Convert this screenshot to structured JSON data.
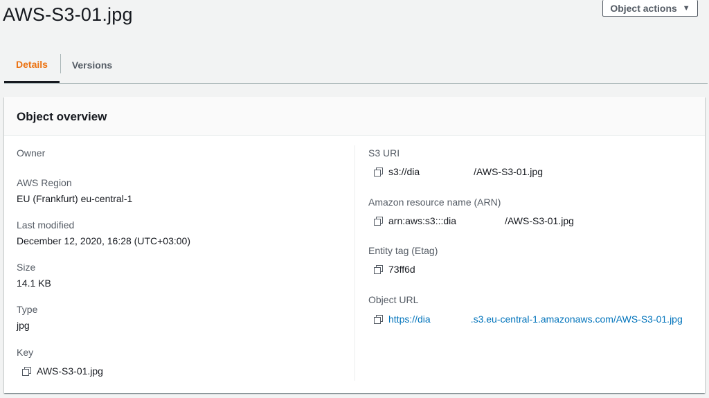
{
  "page": {
    "title": "AWS-S3-01.jpg",
    "actions_label": "Object actions",
    "actions_caret": "▼"
  },
  "tabs": [
    {
      "label": "Details",
      "active": true
    },
    {
      "label": "Versions",
      "active": false
    }
  ],
  "overview": {
    "title": "Object overview",
    "left": {
      "owner_label": "Owner",
      "owner_value": "",
      "region_label": "AWS Region",
      "region_value": "EU (Frankfurt) eu-central-1",
      "modified_label": "Last modified",
      "modified_value": "December 12, 2020, 16:28 (UTC+03:00)",
      "size_label": "Size",
      "size_value": "14.1 KB",
      "type_label": "Type",
      "type_value": "jpg",
      "key_label": "Key",
      "key_value": "AWS-S3-01.jpg"
    },
    "right": {
      "uri_label": "S3 URI",
      "uri_prefix": "s3://dia",
      "uri_suffix": "/AWS-S3-01.jpg",
      "arn_label": "Amazon resource name (ARN)",
      "arn_prefix": "arn:aws:s3:::dia",
      "arn_suffix": "/AWS-S3-01.jpg",
      "etag_label": "Entity tag (Etag)",
      "etag_value": "73ff6d",
      "url_label": "Object URL",
      "url_prefix": "https://dia",
      "url_suffix": ".s3.eu-central-1.amazonaws.com/AWS-S3-01.jpg"
    }
  },
  "colors": {
    "accent": "#ec7211",
    "link": "#0073bb"
  }
}
